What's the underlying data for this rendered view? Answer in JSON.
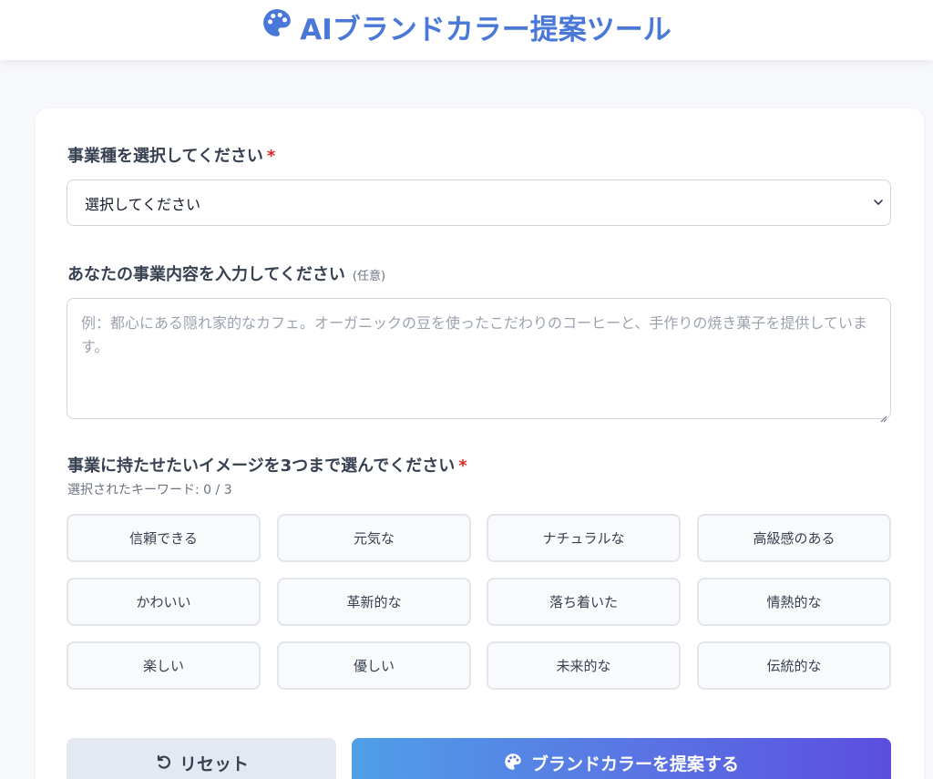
{
  "header": {
    "title": "AIブランドカラー提案ツール",
    "icon": "palette-icon",
    "title_color": "#4a78d8"
  },
  "form": {
    "business_type": {
      "label": "事業種を選択してください",
      "required_mark": "*",
      "selected": "選択してください"
    },
    "business_description": {
      "label": "あなたの事業内容を入力してください",
      "optional_note": "(任意)",
      "placeholder": "例：都心にある隠れ家的なカフェ。オーガニックの豆を使ったこだわりのコーヒーと、手作りの焼き菓子を提供しています。",
      "value": ""
    },
    "keywords": {
      "label": "事業に持たせたいイメージを3つまで選んでください",
      "required_mark": "*",
      "counter": "選択されたキーワード: 0 / 3",
      "items": [
        "信頼できる",
        "元気な",
        "ナチュラルな",
        "高級感のある",
        "かわいい",
        "革新的な",
        "落ち着いた",
        "情熱的な",
        "楽しい",
        "優しい",
        "未来的な",
        "伝統的な"
      ]
    }
  },
  "actions": {
    "reset_label": "リセット",
    "submit_label": "ブランドカラーを提案する"
  },
  "colors": {
    "required": "#dc2626",
    "submit_gradient_start": "#4f9fe8",
    "submit_gradient_end": "#5b4ee0",
    "reset_bg": "#e4e8f0"
  }
}
